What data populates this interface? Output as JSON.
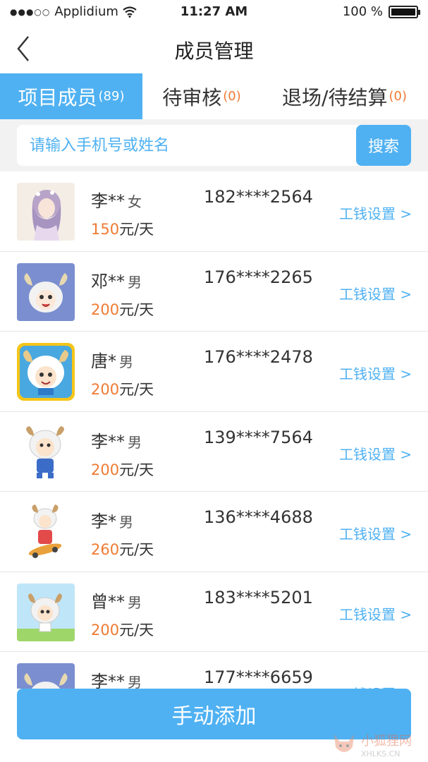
{
  "status_bar": {
    "carrier": "Applidium",
    "time": "11:27 AM",
    "battery": "100 %"
  },
  "nav": {
    "title": "成员管理"
  },
  "tabs": [
    {
      "label": "项目成员",
      "count": "(89)",
      "active": true
    },
    {
      "label": "待审核",
      "count": "(0)",
      "active": false
    },
    {
      "label": "退场/待结算",
      "count": "(0)",
      "active": false
    }
  ],
  "search": {
    "placeholder": "请输入手机号或姓名",
    "button": "搜索"
  },
  "members": [
    {
      "name": "李**",
      "gender": "女",
      "phone": "182****2564",
      "amount": "150",
      "unit": "元/天",
      "link": "工钱设置 >"
    },
    {
      "name": "邓**",
      "gender": "男",
      "phone": "176****2265",
      "amount": "200",
      "unit": "元/天",
      "link": "工钱设置 >"
    },
    {
      "name": "唐*",
      "gender": "男",
      "phone": "176****2478",
      "amount": "200",
      "unit": "元/天",
      "link": "工钱设置 >"
    },
    {
      "name": "李**",
      "gender": "男",
      "phone": "139****7564",
      "amount": "200",
      "unit": "元/天",
      "link": "工钱设置 >"
    },
    {
      "name": "李*",
      "gender": "男",
      "phone": "136****4688",
      "amount": "260",
      "unit": "元/天",
      "link": "工钱设置 >"
    },
    {
      "name": "曾**",
      "gender": "男",
      "phone": "183****5201",
      "amount": "200",
      "unit": "元/天",
      "link": "工钱设置 >"
    },
    {
      "name": "李**",
      "gender": "男",
      "phone": "177****6659",
      "amount": "",
      "unit": "",
      "link": "工钱设置 >"
    }
  ],
  "add_button": "手动添加",
  "watermark": {
    "cn": "小狐狸网",
    "en": "XHLKS.CN"
  },
  "colors": {
    "accent": "#4fb1f2",
    "wage": "#f07a32"
  }
}
